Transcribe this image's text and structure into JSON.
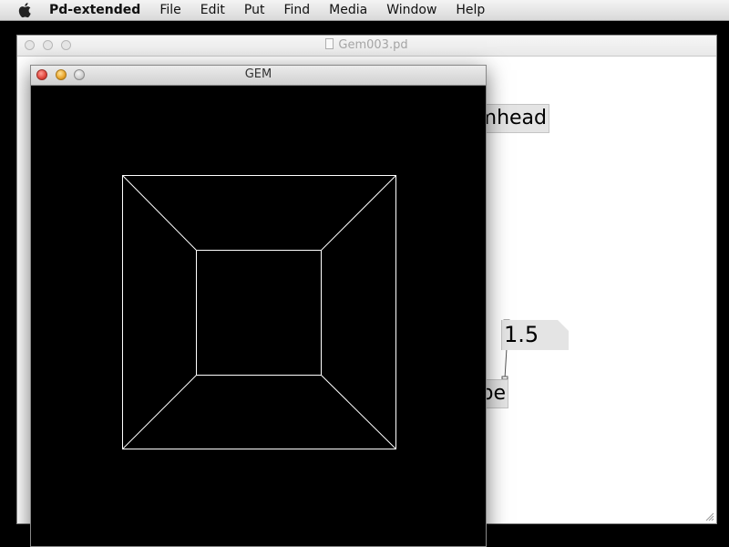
{
  "menubar": {
    "apple_icon": "apple-logo-icon",
    "items": [
      "Pd-extended",
      "File",
      "Edit",
      "Put",
      "Find",
      "Media",
      "Window",
      "Help"
    ]
  },
  "patch_window": {
    "title": "Gem003.pd",
    "title_icon": "document-icon",
    "objects": {
      "gemhead_visible": "mhead",
      "cube_visible": "be"
    },
    "number_box": "1.5"
  },
  "gem_window": {
    "title": "GEM",
    "render": {
      "type": "wireframe-cube",
      "background": "#000000",
      "stroke": "#ffffff"
    }
  },
  "colors": {
    "desktop": "#000000",
    "patch_background": "#ffffff",
    "object_box": "#e4e4e4"
  }
}
